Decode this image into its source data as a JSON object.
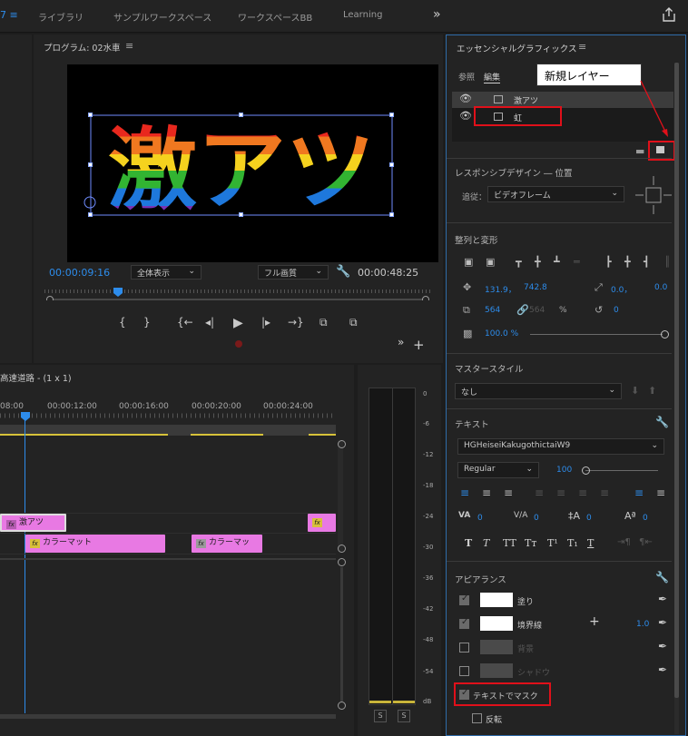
{
  "topbar": {
    "workspaces": [
      "ライブラリ",
      "サンプルワークスペース",
      "ワークスペースBB",
      "Learning"
    ]
  },
  "program": {
    "title": "プログラム: 02水車",
    "video_text": "激アツ",
    "timecode_current": "00:00:09:16",
    "timecode_total": "00:00:48:25",
    "zoom": "全体表示",
    "quality": "フル画質"
  },
  "timeline": {
    "title": "高速道路 - (1 x 1)",
    "times": [
      "08:00",
      "00:00:12:00",
      "00:00:16:00",
      "00:00:20:00",
      "00:00:24:00"
    ],
    "clips": {
      "text1": "激アツ",
      "matte1": "カラーマット",
      "matte2": "カラーマッ"
    }
  },
  "meter": {
    "scale": [
      "0",
      "-6",
      "-12",
      "-18",
      "-24",
      "-30",
      "-36",
      "-42",
      "-48",
      "-54",
      "dB"
    ],
    "solo_left": "S",
    "solo_right": "S"
  },
  "eg": {
    "title": "エッセンシャルグラフィックス",
    "tab_browse": "参照",
    "tab_edit": "編集",
    "layers": [
      "激アツ",
      "虹"
    ],
    "callout": "新規レイヤー",
    "responsive_header": "レスポンシブデザイン ― 位置",
    "follow_label": "追従：",
    "follow_value": "ビデオフレーム",
    "align_header": "整列と変形",
    "pos_x": "131.9，",
    "pos_y": "742.8",
    "anchor_x": "0.0，",
    "anchor_y": "0.0",
    "scale_w": "564",
    "scale_h": "564",
    "scale_unit": "%",
    "rotation": "0",
    "opacity": "100.0 %",
    "master_style_header": "マスタースタイル",
    "master_style_value": "なし",
    "text_header": "テキスト",
    "font": "HGHeiseiKakugothictaiW9",
    "font_style": "Regular",
    "font_size": "100",
    "tracking": "0",
    "kerning": "0",
    "leading": "0",
    "baseline": "0",
    "type_styles": [
      "T",
      "T",
      "TT",
      "Tт",
      "T¹",
      "T₁",
      "T"
    ],
    "appearance_header": "アピアランス",
    "fill": "塗り",
    "stroke": "境界線",
    "stroke_width": "1.0",
    "background": "背景",
    "shadow": "シャドウ",
    "mask": "テキストでマスク",
    "invert": "反転"
  },
  "colors": {
    "accent": "#2d8ceb",
    "highlight": "#e0101a",
    "clip_pink": "#e879e3",
    "rainbow": [
      "#e8281e",
      "#f07820",
      "#f5d21e",
      "#32b432",
      "#1e78dc",
      "#7832b4"
    ]
  }
}
